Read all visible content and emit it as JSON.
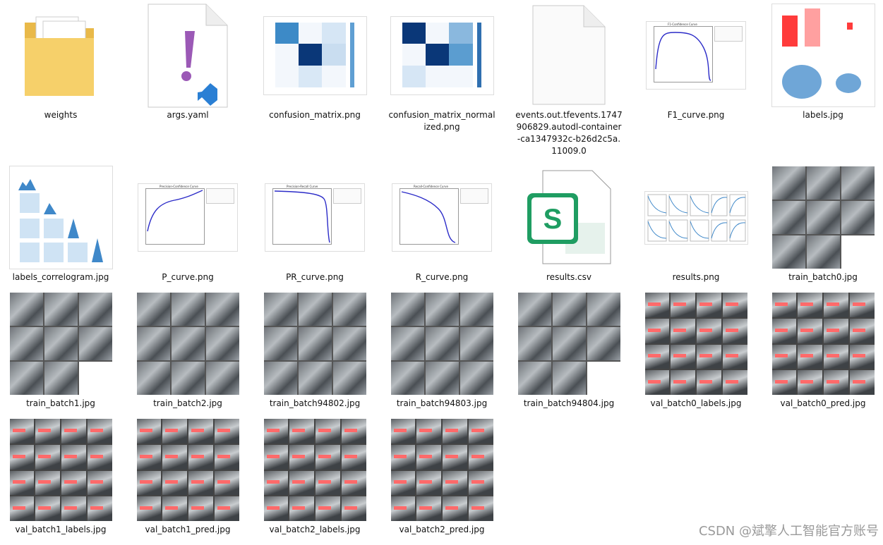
{
  "files": [
    {
      "name": "weights",
      "kind": "folder"
    },
    {
      "name": "args.yaml",
      "kind": "yaml"
    },
    {
      "name": "confusion_matrix.png",
      "kind": "matrix"
    },
    {
      "name": "confusion_matrix_normalized.png",
      "kind": "matrix-dark"
    },
    {
      "name": "events.out.tfevents.1747906829.autodl-container-ca1347932c-b26d2c5a.11009.0",
      "kind": "blank"
    },
    {
      "name": "F1_curve.png",
      "kind": "curve"
    },
    {
      "name": "labels.jpg",
      "kind": "labels"
    },
    {
      "name": "labels_correlogram.jpg",
      "kind": "correlogram"
    },
    {
      "name": "P_curve.png",
      "kind": "curve"
    },
    {
      "name": "PR_curve.png",
      "kind": "curve"
    },
    {
      "name": "R_curve.png",
      "kind": "curve"
    },
    {
      "name": "results.csv",
      "kind": "csv"
    },
    {
      "name": "results.png",
      "kind": "results"
    },
    {
      "name": "train_batch0.jpg",
      "kind": "mosaic"
    },
    {
      "name": "train_batch1.jpg",
      "kind": "mosaic"
    },
    {
      "name": "train_batch2.jpg",
      "kind": "mosaic"
    },
    {
      "name": "train_batch94802.jpg",
      "kind": "mosaic"
    },
    {
      "name": "train_batch94803.jpg",
      "kind": "mosaic"
    },
    {
      "name": "train_batch94804.jpg",
      "kind": "mosaic"
    },
    {
      "name": "val_batch0_labels.jpg",
      "kind": "valgrid"
    },
    {
      "name": "val_batch0_pred.jpg",
      "kind": "valgrid"
    },
    {
      "name": "val_batch1_labels.jpg",
      "kind": "valgrid"
    },
    {
      "name": "val_batch1_pred.jpg",
      "kind": "valgrid"
    },
    {
      "name": "val_batch2_labels.jpg",
      "kind": "valgrid"
    },
    {
      "name": "val_batch2_pred.jpg",
      "kind": "valgrid"
    }
  ],
  "plot_texts": {
    "f1": "F1-Confidence Curve",
    "p": "Precision-Confidence Curve",
    "pr": "Precision-Recall Curve",
    "r": "Recall-Confidence Curve"
  },
  "csv_letter": "S",
  "watermark": "CSDN @斌擎人工智能官方账号"
}
